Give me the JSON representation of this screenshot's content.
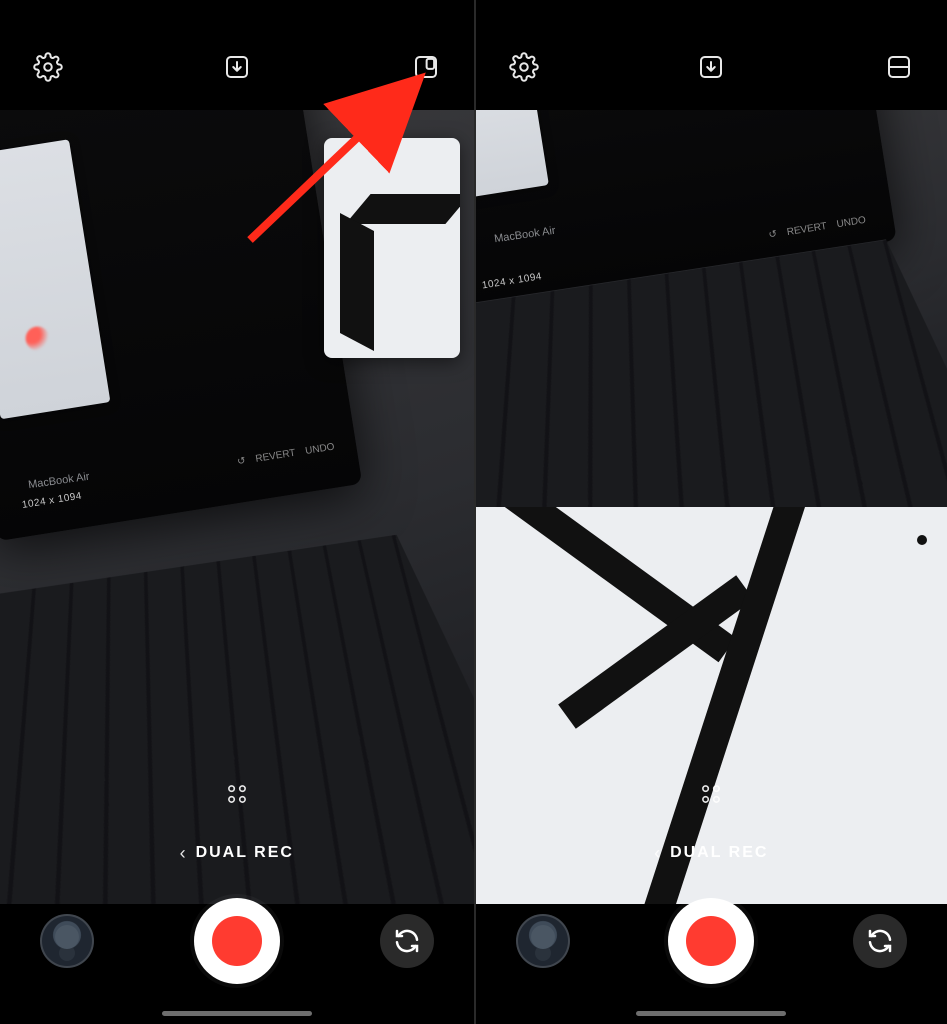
{
  "left": {
    "topbar": {
      "settings_icon": "settings",
      "download_icon": "download",
      "layout_icon_name": "pip-layout-icon"
    },
    "viewfinder": {
      "laptop_label": "MacBook Air",
      "dim_label": "1024 x 1094",
      "revert_label": "REVERT",
      "undo_label": "UNDO"
    },
    "moderow": {
      "chevron": "‹",
      "mode_label": "DUAL REC"
    },
    "annotation": {
      "color": "#ff2a1a"
    }
  },
  "right": {
    "topbar": {
      "settings_icon": "settings",
      "download_icon": "download",
      "layout_icon_name": "split-layout-icon"
    },
    "viewfinder": {
      "laptop_label": "MacBook Air",
      "dim_label": "1024 x 1094",
      "revert_label": "REVERT",
      "undo_label": "UNDO"
    },
    "moderow": {
      "chevron": "‹",
      "mode_label": "DUAL REC"
    }
  }
}
